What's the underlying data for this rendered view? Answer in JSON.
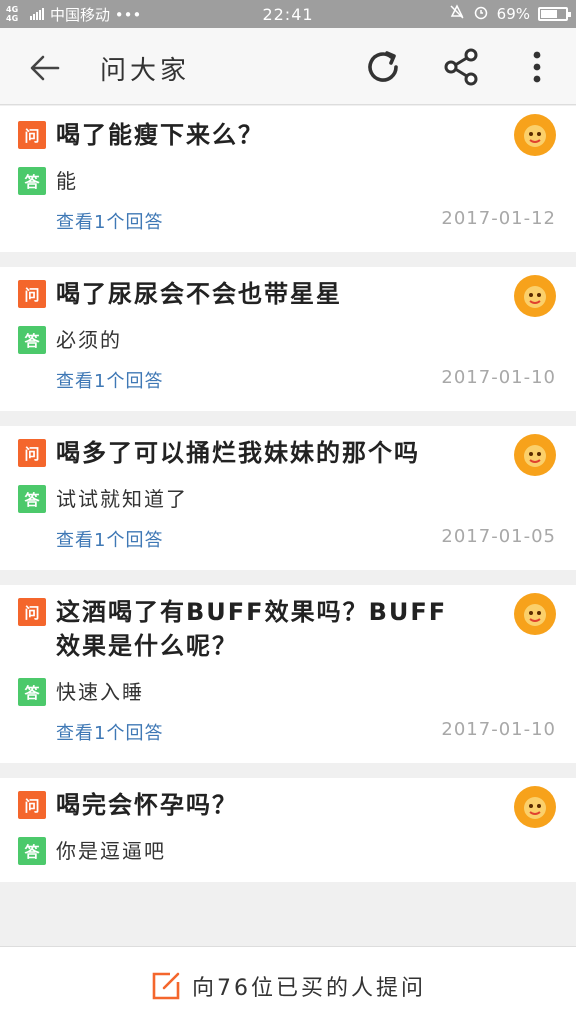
{
  "status_bar": {
    "network": "4G 4G",
    "carrier": "中国移动 •••",
    "time": "22:41",
    "battery_percent": "69%",
    "battery_level": 0.69
  },
  "header": {
    "title": "问大家",
    "back_icon": "arrow-left-icon",
    "refresh_icon": "refresh-icon",
    "share_icon": "share-icon",
    "more_icon": "more-vertical-icon"
  },
  "badges": {
    "question": "问",
    "answer": "答"
  },
  "questions": [
    {
      "question": "喝了能瘦下来么？",
      "answer": "能",
      "answers_link": "查看1个回答",
      "date": "2017-01-12"
    },
    {
      "question": "喝了尿尿会不会也带星星",
      "answer": "必须的",
      "answers_link": "查看1个回答",
      "date": "2017-01-10"
    },
    {
      "question": "喝多了可以捅烂我妹妹的那个吗",
      "answer": "试试就知道了",
      "answers_link": "查看1个回答",
      "date": "2017-01-05"
    },
    {
      "question": "这酒喝了有BUFF效果吗？BUFF效果是什么呢？",
      "answer": "快速入睡",
      "answers_link": "查看1个回答",
      "date": "2017-01-10"
    },
    {
      "question": "喝完会怀孕吗？",
      "answer": "你是逗逼吧",
      "answers_link": "",
      "date": ""
    }
  ],
  "bottom_bar": {
    "ask_label": "向76位已买的人提问",
    "ask_icon": "edit-icon"
  },
  "colors": {
    "accent": "#f4662c",
    "answer_badge": "#4cc96b",
    "link": "#3f78b5",
    "avatar": "#f7a21b"
  }
}
